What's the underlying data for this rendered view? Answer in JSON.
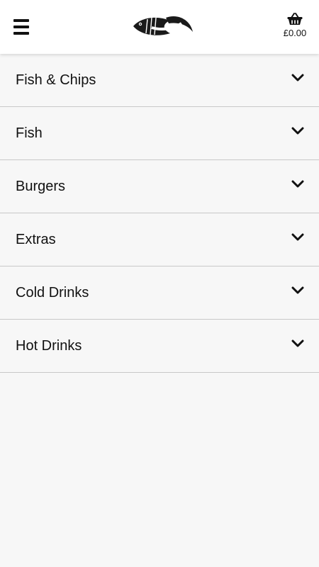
{
  "header": {
    "logo_text": "fish chips",
    "basket_total": "£0.00"
  },
  "menu": {
    "categories": [
      {
        "label": "Fish & Chips",
        "icon": "chevron-down-icon"
      },
      {
        "label": "Fish",
        "icon": "chevron-down-icon"
      },
      {
        "label": "Burgers",
        "icon": "chevron-down-icon"
      },
      {
        "label": "Extras",
        "icon": "chevron-down-icon"
      },
      {
        "label": "Cold Drinks",
        "icon": "chevron-down-icon"
      },
      {
        "label": "Hot Drinks",
        "icon": "chevron-down-icon"
      }
    ]
  },
  "icons": {
    "menu": "hamburger-menu-icon",
    "basket": "basket-icon"
  },
  "colors": {
    "header_bg": "#ffffff",
    "page_bg": "#f7f7f7",
    "text": "#111111",
    "divider": "#c8c8c8"
  }
}
